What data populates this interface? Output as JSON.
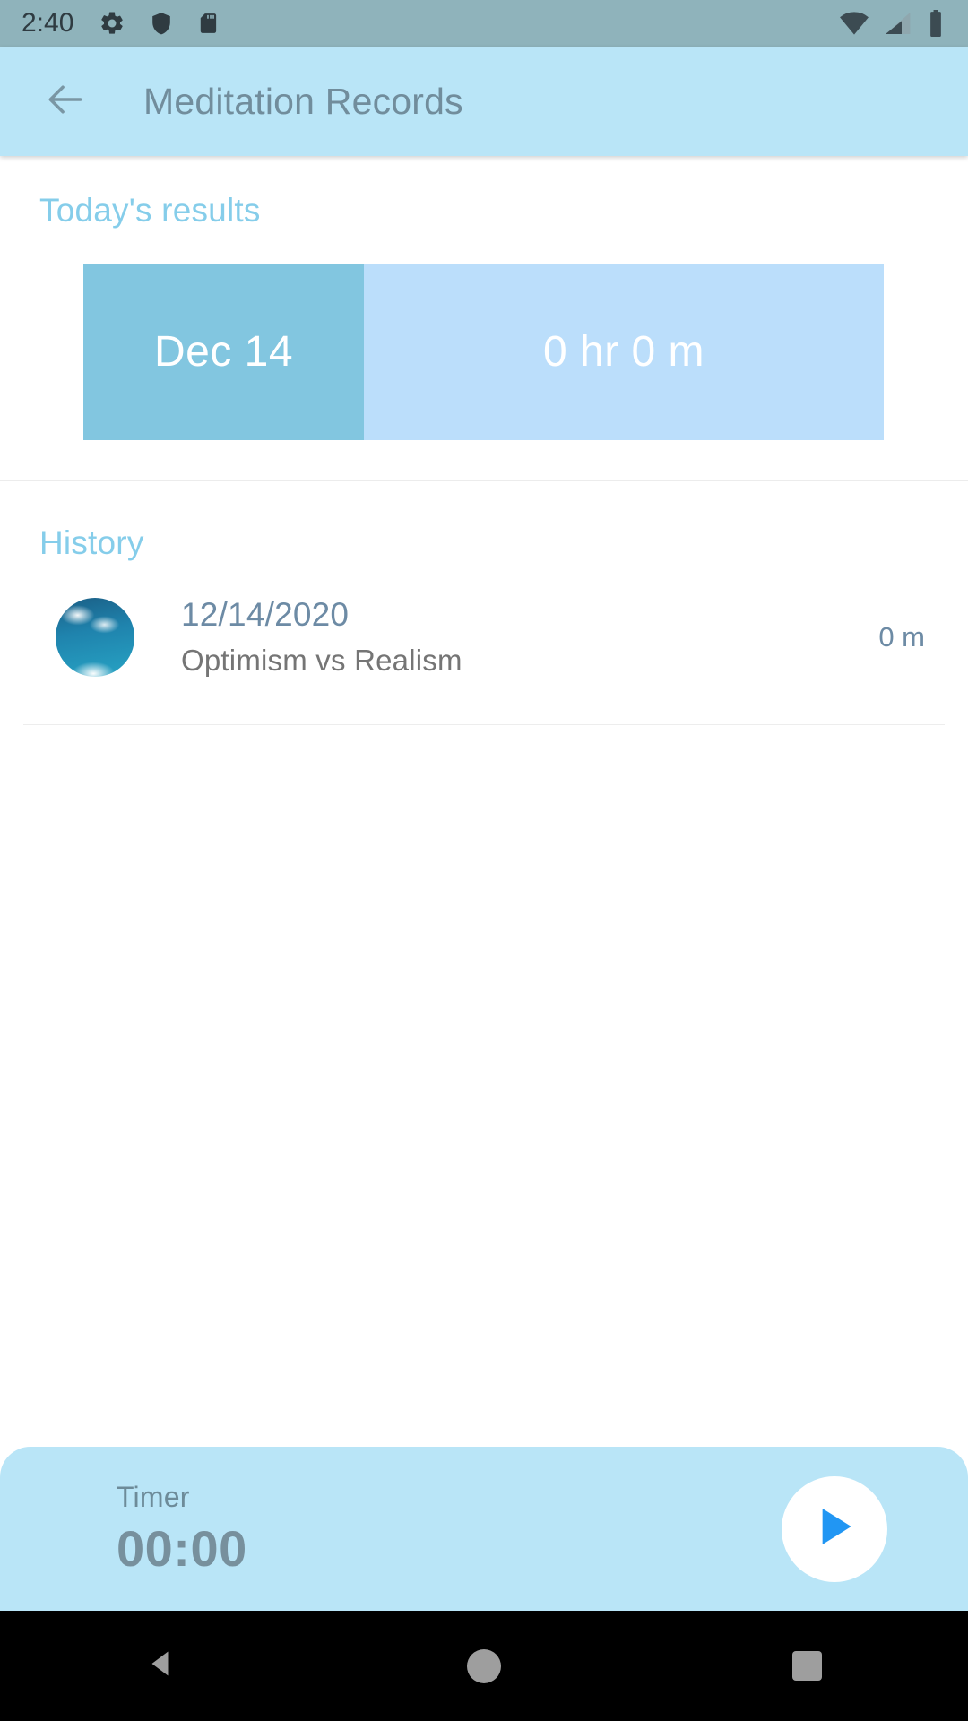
{
  "status_bar": {
    "clock": "2:40",
    "left_icons": [
      "gear-icon",
      "shield-icon",
      "sd-card-icon"
    ],
    "right_icons": [
      "wifi-icon",
      "cellular-signal-icon",
      "battery-icon"
    ],
    "background_color": "#8fb3bb"
  },
  "app_bar": {
    "back_icon": "arrow-left-icon",
    "title": "Meditation Records",
    "background_color": "#b9e5f7",
    "title_color": "#718d9c"
  },
  "today": {
    "section_title": "Today's results",
    "date_label": "Dec 14",
    "duration_label": "0 hr 0 m",
    "date_cell_color": "#82c6e0",
    "duration_cell_color": "#bbdefb"
  },
  "history": {
    "section_title": "History",
    "items": [
      {
        "thumbnail": "sky-clouds-thumbnail",
        "date": "12/14/2020",
        "title": "Optimism vs Realism",
        "duration": "0 m"
      }
    ]
  },
  "timer": {
    "label": "Timer",
    "value": "00:00",
    "play_icon": "play-icon",
    "background_color": "#b9e5f7",
    "play_icon_color": "#2196f3"
  },
  "nav_bar": {
    "back": "triangle-back-icon",
    "home": "circle-home-icon",
    "recents": "square-recents-icon"
  },
  "accent_color": "#85cdea"
}
